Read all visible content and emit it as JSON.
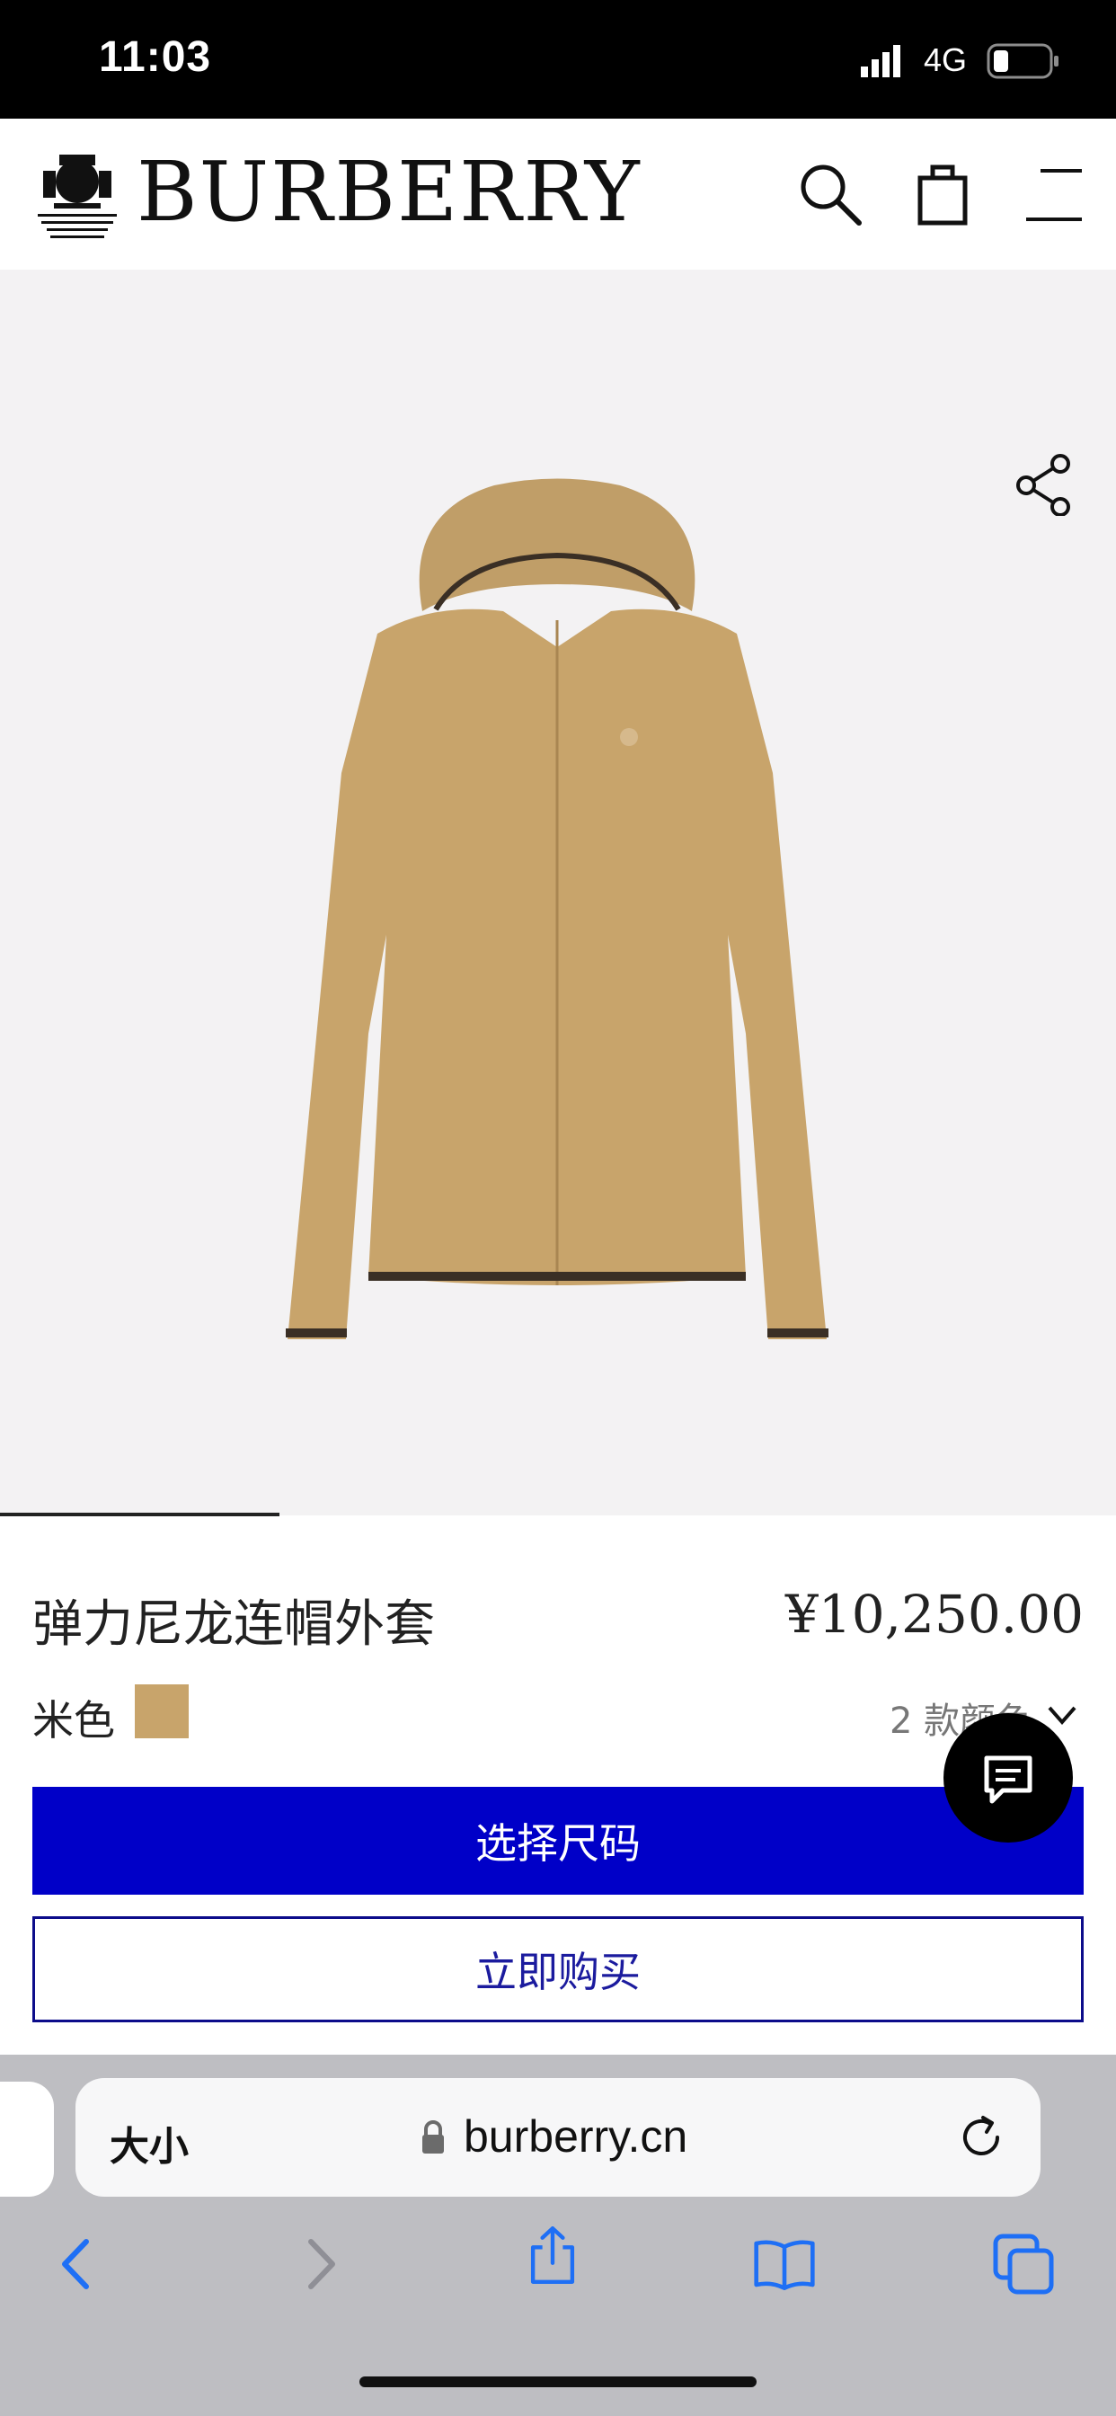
{
  "status_bar": {
    "time": "11:03",
    "network": "4G"
  },
  "header": {
    "brand": "BURBERRY",
    "crest_text": "BY APPOINTMENT TO HER MAJESTY KING CHARLES III OUTFITTERS BURBERRY LIMITED LONDON",
    "icons": [
      "search-icon",
      "shopping-bag-icon",
      "menu-icon"
    ]
  },
  "product": {
    "title": "弹力尼龙连帽外套",
    "price": "¥10,250.00",
    "color_label": "米色",
    "swatch_color": "#c8a46b",
    "colors_count": "2 款颜色",
    "image_progress": 0.25,
    "select_size_label": "选择尺码",
    "buy_now_label": "立即购买"
  },
  "colors": {
    "accent": "#0000c8",
    "jacket": "#c8a46b"
  },
  "browser": {
    "text_size_label": "大小",
    "url": "burberry.cn"
  }
}
